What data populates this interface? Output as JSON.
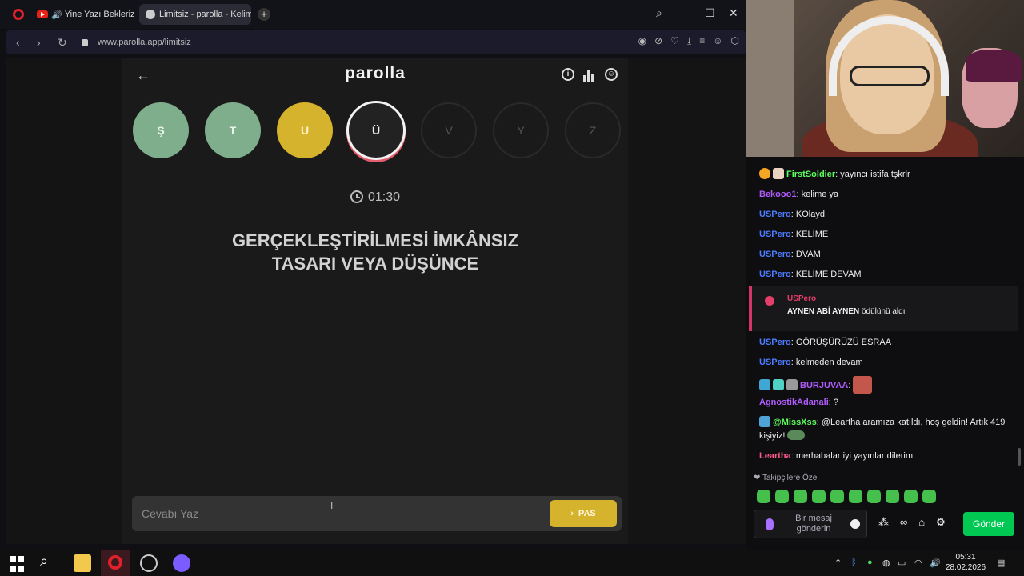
{
  "browser": {
    "tabs": [
      {
        "label": "Yine Yazı Bekleriz - Yo",
        "active": false
      },
      {
        "label": "Limitsiz - parolla - Kelime",
        "active": true
      }
    ],
    "url": "www.parolla.app/limitsiz"
  },
  "game": {
    "brand": "parolla",
    "letters": [
      {
        "char": "Ş",
        "state": "correct"
      },
      {
        "char": "T",
        "state": "correct"
      },
      {
        "char": "U",
        "state": "passed"
      },
      {
        "char": "Ü",
        "state": "current"
      },
      {
        "char": "V",
        "state": "pending"
      },
      {
        "char": "Y",
        "state": "pending"
      },
      {
        "char": "Z",
        "state": "pending"
      }
    ],
    "timer": "01:30",
    "question_line1": "GERÇEKLEŞTİRİLMESİ İMKÂNSIZ",
    "question_line2": "TASARI VEYA DÜŞÜNCE",
    "answer_placeholder": "Cevabı Yaz",
    "pass_label": "PAS"
  },
  "chat": {
    "messages": [
      {
        "user": "FirstSoldier",
        "color": "#5cff5c",
        "text": "yayıncı istifa tşkrlr"
      },
      {
        "user": "Bekooo1",
        "color": "#b15cff",
        "text": "kelime ya"
      },
      {
        "user": "USPero",
        "color": "#4d7cff",
        "text": "KOlaydı"
      },
      {
        "user": "USPero",
        "color": "#4d7cff",
        "text": "KELİME"
      },
      {
        "user": "USPero",
        "color": "#4d7cff",
        "text": "DVAM"
      },
      {
        "user": "USPero",
        "color": "#4d7cff",
        "text": "KELİME DEVAM"
      },
      {
        "user": "USPero",
        "color": "#4d7cff",
        "text": "GÖRÜŞÜRÜZÜ ESRAA"
      },
      {
        "user": "USPero",
        "color": "#4d7cff",
        "text": "kelmeden devam"
      },
      {
        "user": "BURJUVAA",
        "color": "#b15cff",
        "text": ""
      },
      {
        "user": "AgnostikAdanali",
        "color": "#b15cff",
        "text": "?"
      },
      {
        "user": "@MissXss",
        "color": "#5cff5c",
        "text": "@Leartha aramıza katıldı, hoş geldin! Artık 419 kişiyiz!"
      },
      {
        "user": "Leartha",
        "color": "#ff5c8a",
        "text": "merhabalar iyi yayınlar dilerim"
      }
    ],
    "reward": {
      "user": "USPero",
      "text_bold": "AYNEN ABİ AYNEN",
      "text": "ödülünü aldı"
    },
    "followers_only": "Takipçilere Özel",
    "input_placeholder": "Bir mesaj gönderin",
    "send_label": "Gönder"
  },
  "taskbar": {
    "time": "05:31",
    "date": "28.02.2026"
  }
}
